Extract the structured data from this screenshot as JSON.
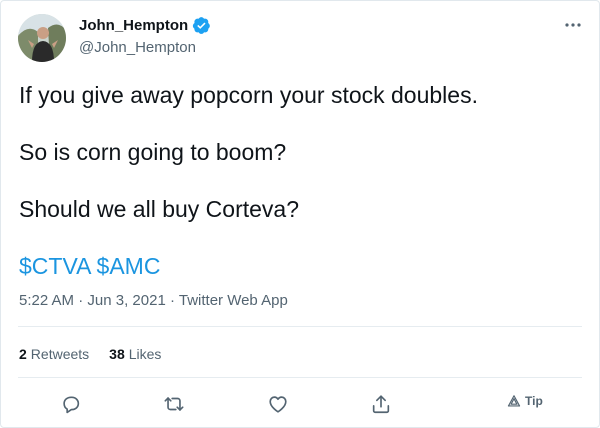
{
  "user": {
    "display_name": "John_Hempton",
    "handle": "@John_Hempton"
  },
  "tweet": {
    "line1": "If you give away popcorn your stock doubles.",
    "line2": "So is corn going to boom?",
    "line3": "Should we all buy Corteva?",
    "cashtag1": "$CTVA",
    "cashtag2": "$AMC"
  },
  "meta": {
    "time": "5:22 AM",
    "date": "Jun 3, 2021",
    "source": "Twitter Web App",
    "sep": " · "
  },
  "stats": {
    "retweets_count": "2",
    "retweets_label": "Retweets",
    "likes_count": "38",
    "likes_label": "Likes"
  },
  "actions": {
    "tip_label": "Tip"
  },
  "icons": {
    "verified": "verified-badge-icon",
    "more": "more-icon",
    "reply": "reply-icon",
    "retweet": "retweet-icon",
    "like": "heart-icon",
    "share": "share-icon",
    "tip": "tip-icon"
  },
  "colors": {
    "link": "#1b95e0",
    "verified": "#1da1f2",
    "secondary_text": "#536471"
  }
}
